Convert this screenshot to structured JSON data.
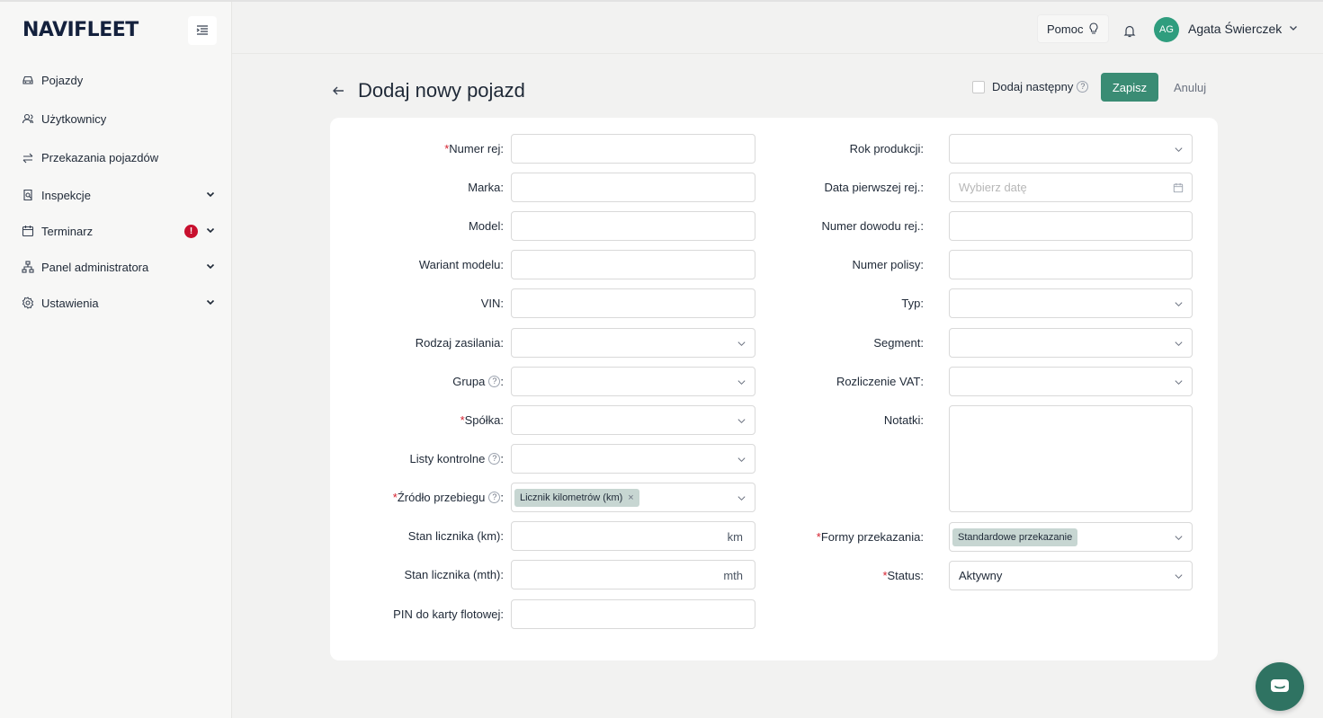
{
  "app": {
    "logo": "NAVIFLEET"
  },
  "sidebar": {
    "items": [
      {
        "label": "Pojazdy",
        "icon": "car-icon"
      },
      {
        "label": "Użytkownicy",
        "icon": "users-icon"
      },
      {
        "label": "Przekazania pojazdów",
        "icon": "transfer-icon"
      },
      {
        "label": "Inspekcje",
        "icon": "inspection-icon",
        "expandable": true
      },
      {
        "label": "Terminarz",
        "icon": "calendar-icon",
        "expandable": true,
        "alert": "!"
      },
      {
        "label": "Panel administratora",
        "icon": "org-chart-icon",
        "expandable": true
      },
      {
        "label": "Ustawienia",
        "icon": "gear-icon",
        "expandable": true
      }
    ]
  },
  "header": {
    "help_label": "Pomoc",
    "user": {
      "initials": "AG",
      "name": "Agata Świerczek"
    }
  },
  "page": {
    "title": "Dodaj nowy pojazd",
    "add_next_label": "Dodaj następny",
    "save_label": "Zapisz",
    "cancel_label": "Anuluj"
  },
  "form": {
    "left": {
      "numer_rej": {
        "label": "Numer rej",
        "required": true,
        "value": ""
      },
      "marka": {
        "label": "Marka",
        "value": ""
      },
      "model": {
        "label": "Model",
        "value": ""
      },
      "wariant": {
        "label": "Wariant modelu",
        "value": ""
      },
      "vin": {
        "label": "VIN",
        "value": ""
      },
      "zasilanie": {
        "label": "Rodzaj zasilania",
        "value": ""
      },
      "grupa": {
        "label": "Grupa",
        "value": ""
      },
      "spolka": {
        "label": "Spółka",
        "required": true,
        "value": ""
      },
      "listy": {
        "label": "Listy kontrolne",
        "value": ""
      },
      "zrodlo": {
        "label": "Źródło przebiegu",
        "required": true,
        "tag": "Licznik kilometrów (km)"
      },
      "stan_km": {
        "label": "Stan licznika (km)",
        "suffix": "km",
        "value": ""
      },
      "stan_mth": {
        "label": "Stan licznika (mth)",
        "suffix": "mth",
        "value": ""
      },
      "pin": {
        "label": "PIN do karty flotowej",
        "value": ""
      }
    },
    "right": {
      "rok": {
        "label": "Rok produkcji",
        "value": ""
      },
      "data_rej": {
        "label": "Data pierwszej rej.",
        "placeholder": "Wybierz datę"
      },
      "dowod": {
        "label": "Numer dowodu rej.",
        "value": ""
      },
      "polisa": {
        "label": "Numer polisy",
        "value": ""
      },
      "typ": {
        "label": "Typ",
        "value": ""
      },
      "segment": {
        "label": "Segment",
        "value": ""
      },
      "vat": {
        "label": "Rozliczenie VAT",
        "value": ""
      },
      "notatki": {
        "label": "Notatki",
        "value": ""
      },
      "formy": {
        "label": "Formy przekazania",
        "required": true,
        "tag": "Standardowe przekazanie"
      },
      "status": {
        "label": "Status",
        "required": true,
        "value": "Aktywny"
      }
    }
  }
}
